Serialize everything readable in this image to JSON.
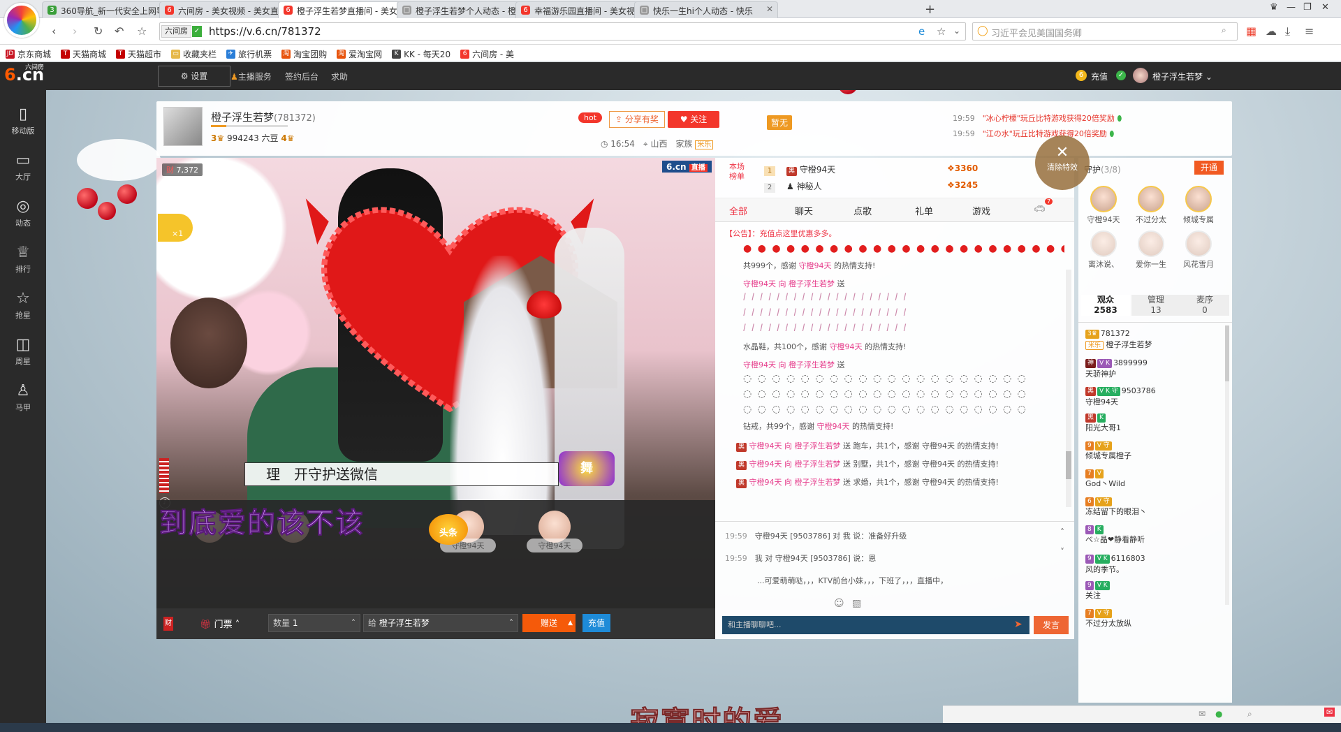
{
  "browser": {
    "tabs": [
      {
        "title": "360导航_新一代安全上网导",
        "fav_color": "#3a9f3a",
        "fav": "3"
      },
      {
        "title": "六间房 - 美女视频 - 美女直",
        "fav_color": "#f3362b",
        "fav": "6"
      },
      {
        "title": "橙子浮生若梦直播间 - 美女",
        "fav_color": "#f3362b",
        "fav": "6"
      },
      {
        "title": "橙子浮生若梦个人动态 - 橙",
        "fav_color": "#999999",
        "fav": "□"
      },
      {
        "title": "幸福游乐园直播间 - 美女视",
        "fav_color": "#f3362b",
        "fav": "6"
      },
      {
        "title": "快乐一生hi个人动态 - 快乐",
        "fav_color": "#999999",
        "fav": "□"
      }
    ],
    "site_badge": "六间房",
    "url": "https://v.6.cn/781372",
    "search_placeholder": "习近平会见美国国务卿",
    "bookmarks": [
      {
        "label": "京东商城",
        "icon": "JD",
        "color": "#c81623"
      },
      {
        "label": "天猫商城",
        "icon": "T",
        "color": "#c40000"
      },
      {
        "label": "天猫超市",
        "icon": "T",
        "color": "#c40000"
      },
      {
        "label": "收藏夹栏",
        "icon": "▭",
        "color": "#e6b84a"
      },
      {
        "label": "旅行机票",
        "icon": "✈",
        "color": "#2a7ed8"
      },
      {
        "label": "淘宝团购",
        "icon": "淘",
        "color": "#e8540d"
      },
      {
        "label": "爱淘宝网",
        "icon": "淘",
        "color": "#e8540d"
      },
      {
        "label": "KK - 每天20",
        "icon": "K",
        "color": "#444444"
      },
      {
        "label": "六间房 - 美",
        "icon": "6",
        "color": "#f3362b"
      }
    ]
  },
  "site": {
    "logo_six": "6",
    "logo_cn": ".cn",
    "logo_small": "六间房",
    "settings": "设置",
    "links": [
      "主播服务",
      "签约后台",
      "求助"
    ],
    "recharge": "充值",
    "user": "橙子浮生若梦",
    "leftnav": [
      {
        "label": "移动版",
        "icon": "▯",
        "icon_name": "mobile-icon"
      },
      {
        "label": "大厅",
        "icon": "▭",
        "icon_name": "tv-icon"
      },
      {
        "label": "动态",
        "icon": "◎",
        "icon_name": "compass-icon"
      },
      {
        "label": "排行",
        "icon": "♕",
        "icon_name": "crown-icon"
      },
      {
        "label": "抢星",
        "icon": "☆",
        "icon_name": "star-icon"
      },
      {
        "label": "周星",
        "icon": "◫",
        "icon_name": "gift-box-icon"
      },
      {
        "label": "马甲",
        "icon": "♙",
        "icon_name": "vest-icon"
      }
    ]
  },
  "anchor": {
    "name": "橙子浮生若梦",
    "id": "(781372)",
    "level": "3",
    "beans": "994243 六豆",
    "fans_level": "4",
    "hot": "hot",
    "share": "分享有奖",
    "follow": "关注",
    "time": "16:54",
    "location": "山西",
    "family_label": "家族",
    "family": "米乐",
    "flag": "暂无"
  },
  "notices": [
    {
      "time": "19:59",
      "text": "\"冰心柠檬\"玩丘比特游戏获得20倍奖励"
    },
    {
      "time": "19:59",
      "text": "\"江の水\"玩丘比特游戏获得20倍奖励"
    }
  ],
  "video": {
    "watermark": "6.cn",
    "live": "直播",
    "viewers": "7,372",
    "viewers_prefix": "财",
    "multiplier": "×1",
    "subtitle": "理　开守护送微信",
    "lyric_top": "到底爱的该不该",
    "lyric_bottom": "寂寞时的爱",
    "headline": "头条",
    "seats": [
      "守橙94天",
      "守橙94天"
    ],
    "dance_badge": "舞"
  },
  "giftbar": {
    "ticket": "门票",
    "qty_label": "数量",
    "qty": "1",
    "to_label": "给",
    "to": "橙子浮生若梦",
    "send": "赠送",
    "recharge": "充值"
  },
  "chat": {
    "rank_label": "本场榜单",
    "ranks": [
      {
        "num": "1",
        "name": "守橙94天",
        "coins": "3360"
      },
      {
        "num": "2",
        "name": "神秘人",
        "coins": "3245"
      }
    ],
    "clear_fx": "清除特效",
    "tabs": [
      "全部",
      "聊天",
      "点歌",
      "礼单",
      "游戏"
    ],
    "announce": "【公告】：充值点这里优惠多多。",
    "messages": [
      {
        "text": "共999个，感谢 ",
        "user": "守橙94天",
        "tail": " 的热情支持!"
      },
      {
        "text": "守橙94天 向 ",
        "user": "橙子浮生若梦",
        "tail": " 送"
      },
      {
        "text": "水晶鞋，共100个，感谢 ",
        "user": "守橙94天",
        "tail": " 的热情支持!"
      },
      {
        "text": "守橙94天 向 ",
        "user": "橙子浮生若梦",
        "tail": " 送"
      },
      {
        "text": "钻戒，共99个，感谢 ",
        "user": "守橙94天",
        "tail": " 的热情支持!"
      },
      {
        "text": "守橙94天 向 ",
        "user": "橙子浮生若梦",
        "tail": " 送 跑车，共1个，感谢 守橙94天 的热情支持!"
      },
      {
        "text": "守橙94天 向 ",
        "user": "橙子浮生若梦",
        "tail": " 送 别墅，共1个，感谢 守橙94天 的热情支持!"
      },
      {
        "text": "守橙94天 向 ",
        "user": "橙子浮生若梦",
        "tail": " 送 求婚，共1个，感谢 守橙94天 的热情支持!"
      }
    ],
    "private": [
      {
        "time": "19:59",
        "text": "守橙94天 [9503786] 对 我 说：准备好升级"
      },
      {
        "time": "19:59",
        "text": "我 对 守橙94天 [9503786] 说：恩"
      },
      {
        "time": "",
        "text": "...可爱萌萌哒，，，KTV前台小妹，，，下班了，，，直播中，"
      }
    ],
    "input_placeholder": "和主播聊聊吧...",
    "send": "发言",
    "tab_badge": "7"
  },
  "guard": {
    "title": "守护",
    "count": "(3/8)",
    "open": "开通",
    "members": [
      {
        "name": "守橙94天",
        "dim": false
      },
      {
        "name": "不过分太",
        "dim": false
      },
      {
        "name": "倾城专属",
        "dim": false
      },
      {
        "name": "离沐说、",
        "dim": true
      },
      {
        "name": "爱你一生",
        "dim": true
      },
      {
        "name": "风花雪月",
        "dim": true
      }
    ]
  },
  "audience": {
    "tabs": [
      {
        "label": "观众",
        "count": "2583"
      },
      {
        "label": "管理",
        "count": "13"
      },
      {
        "label": "麦序",
        "count": "0"
      }
    ],
    "list": [
      {
        "id": "781372",
        "name": "橙子浮生若梦",
        "tag": "米乐"
      },
      {
        "id": "3899999",
        "name": "天骄神护",
        "tag": "V K"
      },
      {
        "id": "9503786",
        "name": "守橙94天",
        "tag": "V K 守"
      },
      {
        "id": "",
        "name": "阳光大哥1",
        "tag": "K"
      },
      {
        "id": "",
        "name": "倾城专属橙子",
        "tag": "V 守"
      },
      {
        "id": "",
        "name": "God丶Wild",
        "tag": "V"
      },
      {
        "id": "",
        "name": "冻结留下的眼泪丶",
        "tag": "V 守"
      },
      {
        "id": "",
        "name": "べ☆晶❤静看静听",
        "tag": "K"
      },
      {
        "id": "6116803",
        "name": "风的季节。",
        "tag": "V K"
      },
      {
        "id": "",
        "name": "关注",
        "tag": "V K"
      },
      {
        "id": "",
        "name": "不过分太放纵",
        "tag": "V 守"
      }
    ]
  }
}
